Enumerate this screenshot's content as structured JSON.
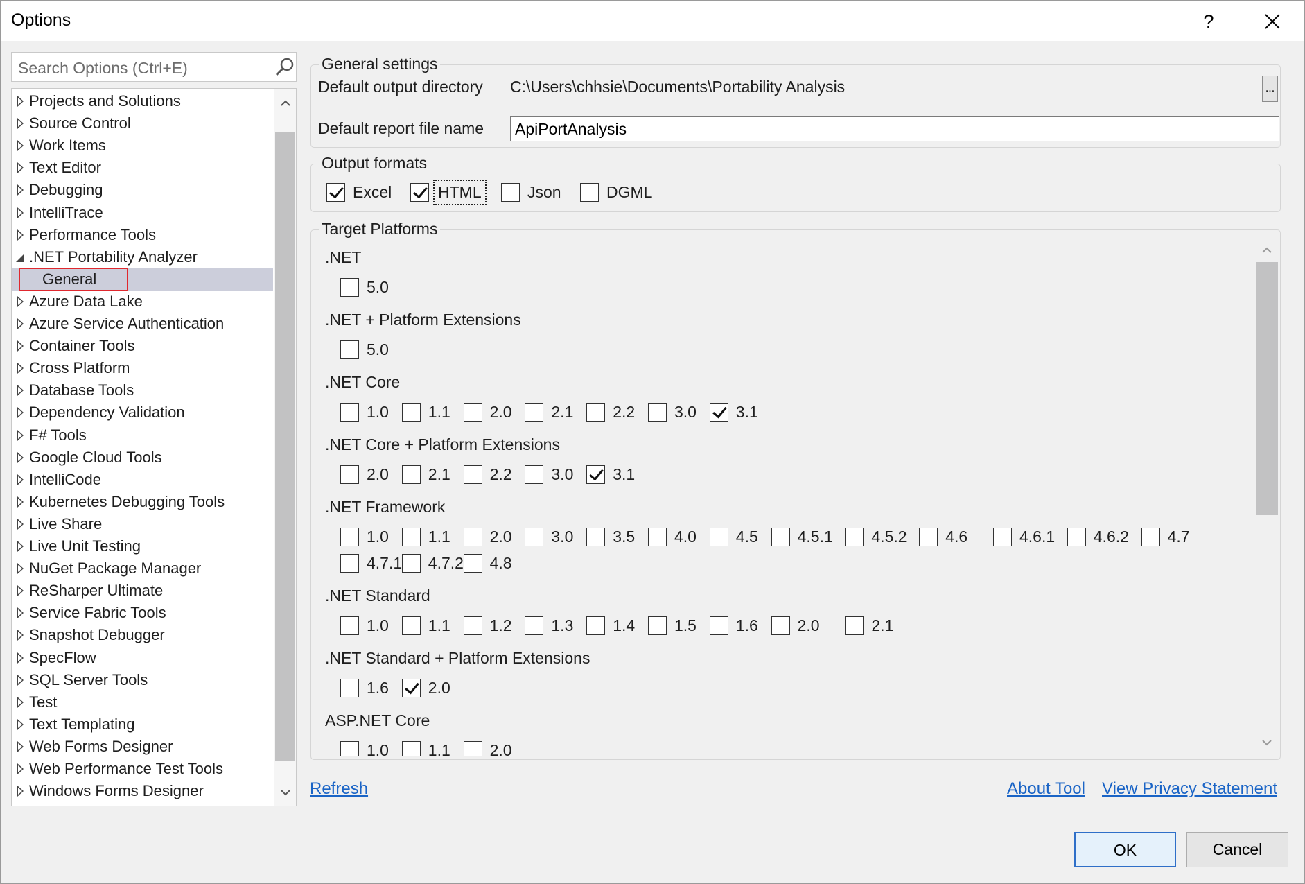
{
  "window": {
    "title": "Options",
    "help_label": "?"
  },
  "search": {
    "placeholder": "Search Options (Ctrl+E)"
  },
  "tree": {
    "items": [
      {
        "label": "Projects and Solutions"
      },
      {
        "label": "Source Control"
      },
      {
        "label": "Work Items"
      },
      {
        "label": "Text Editor"
      },
      {
        "label": "Debugging"
      },
      {
        "label": "IntelliTrace"
      },
      {
        "label": "Performance Tools"
      },
      {
        "label": ".NET Portability Analyzer",
        "expanded": true
      },
      {
        "label": "General",
        "child": true,
        "selected": true
      },
      {
        "label": "Azure Data Lake"
      },
      {
        "label": "Azure Service Authentication"
      },
      {
        "label": "Container Tools"
      },
      {
        "label": "Cross Platform"
      },
      {
        "label": "Database Tools"
      },
      {
        "label": "Dependency Validation"
      },
      {
        "label": "F# Tools"
      },
      {
        "label": "Google Cloud Tools"
      },
      {
        "label": "IntelliCode"
      },
      {
        "label": "Kubernetes Debugging Tools"
      },
      {
        "label": "Live Share"
      },
      {
        "label": "Live Unit Testing"
      },
      {
        "label": "NuGet Package Manager"
      },
      {
        "label": "ReSharper Ultimate"
      },
      {
        "label": "Service Fabric Tools"
      },
      {
        "label": "Snapshot Debugger"
      },
      {
        "label": "SpecFlow"
      },
      {
        "label": "SQL Server Tools"
      },
      {
        "label": "Test"
      },
      {
        "label": "Text Templating"
      },
      {
        "label": "Web Forms Designer"
      },
      {
        "label": "Web Performance Test Tools"
      },
      {
        "label": "Windows Forms Designer"
      }
    ]
  },
  "general_settings": {
    "title": "General settings",
    "output_dir_label": "Default output directory",
    "output_dir_value": "C:\\Users\\chhsie\\Documents\\Portability Analysis",
    "browse_label": "...",
    "report_name_label": "Default report file name",
    "report_name_value": "ApiPortAnalysis"
  },
  "output_formats": {
    "title": "Output formats",
    "items": [
      {
        "label": "Excel",
        "checked": true
      },
      {
        "label": "HTML",
        "checked": true,
        "focused": true
      },
      {
        "label": "Json",
        "checked": false
      },
      {
        "label": "DGML",
        "checked": false
      }
    ]
  },
  "target_platforms": {
    "title": "Target Platforms",
    "platforms": [
      {
        "name": ".NET",
        "versions": [
          {
            "v": "5.0",
            "checked": false
          }
        ]
      },
      {
        "name": ".NET + Platform Extensions",
        "versions": [
          {
            "v": "5.0",
            "checked": false
          }
        ]
      },
      {
        "name": ".NET Core",
        "versions": [
          {
            "v": "1.0",
            "checked": false
          },
          {
            "v": "1.1",
            "checked": false
          },
          {
            "v": "2.0",
            "checked": false
          },
          {
            "v": "2.1",
            "checked": false
          },
          {
            "v": "2.2",
            "checked": false
          },
          {
            "v": "3.0",
            "checked": false
          },
          {
            "v": "3.1",
            "checked": true
          }
        ]
      },
      {
        "name": ".NET Core + Platform Extensions",
        "versions": [
          {
            "v": "2.0",
            "checked": false
          },
          {
            "v": "2.1",
            "checked": false
          },
          {
            "v": "2.2",
            "checked": false
          },
          {
            "v": "3.0",
            "checked": false
          },
          {
            "v": "3.1",
            "checked": true
          }
        ]
      },
      {
        "name": ".NET Framework",
        "versions": [
          {
            "v": "1.0",
            "checked": false
          },
          {
            "v": "1.1",
            "checked": false
          },
          {
            "v": "2.0",
            "checked": false
          },
          {
            "v": "3.0",
            "checked": false
          },
          {
            "v": "3.5",
            "checked": false
          },
          {
            "v": "4.0",
            "checked": false
          },
          {
            "v": "4.5",
            "checked": false
          },
          {
            "v": "4.5.1",
            "checked": false
          },
          {
            "v": "4.5.2",
            "checked": false
          },
          {
            "v": "4.6",
            "checked": false
          },
          {
            "v": "4.6.1",
            "checked": false
          },
          {
            "v": "4.6.2",
            "checked": false
          },
          {
            "v": "4.7",
            "checked": false
          },
          {
            "v": "4.7.1",
            "checked": false
          },
          {
            "v": "4.7.2",
            "checked": false
          },
          {
            "v": "4.8",
            "checked": false
          }
        ]
      },
      {
        "name": ".NET Standard",
        "versions": [
          {
            "v": "1.0",
            "checked": false
          },
          {
            "v": "1.1",
            "checked": false
          },
          {
            "v": "1.2",
            "checked": false
          },
          {
            "v": "1.3",
            "checked": false
          },
          {
            "v": "1.4",
            "checked": false
          },
          {
            "v": "1.5",
            "checked": false
          },
          {
            "v": "1.6",
            "checked": false
          },
          {
            "v": "2.0",
            "checked": false
          },
          {
            "v": "2.1",
            "checked": false
          }
        ]
      },
      {
        "name": ".NET Standard + Platform Extensions",
        "versions": [
          {
            "v": "1.6",
            "checked": false
          },
          {
            "v": "2.0",
            "checked": true
          }
        ]
      },
      {
        "name": "ASP.NET Core",
        "versions": [
          {
            "v": "1.0",
            "checked": false
          },
          {
            "v": "1.1",
            "checked": false
          },
          {
            "v": "2.0",
            "checked": false
          }
        ]
      }
    ]
  },
  "links": {
    "refresh": "Refresh",
    "about": "About Tool",
    "privacy": "View Privacy Statement"
  },
  "buttons": {
    "ok": "OK",
    "cancel": "Cancel"
  }
}
